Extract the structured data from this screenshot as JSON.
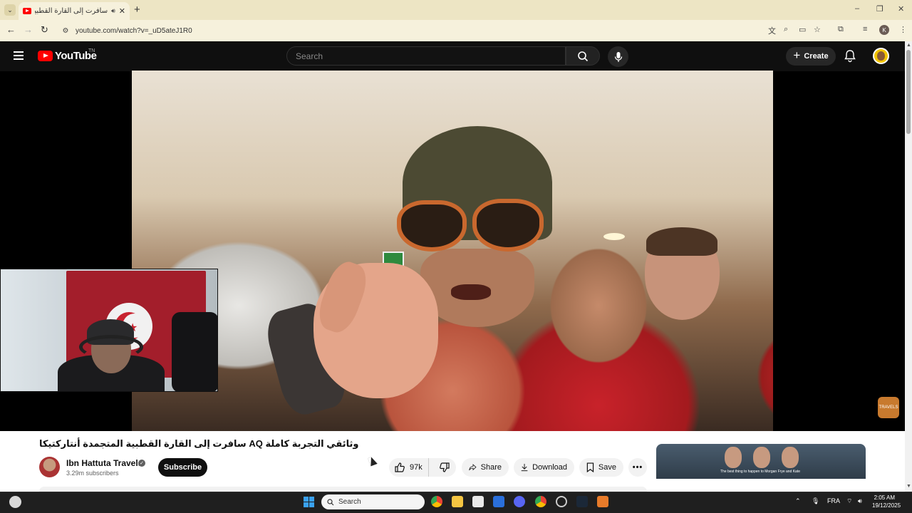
{
  "browser": {
    "tab_title": "سافرت إلى القارة القطبية ال",
    "tab_icon": "youtube-favicon-icon",
    "audio_icon": "speaker-icon",
    "close_glyph": "✕",
    "newtab_glyph": "+",
    "url": "youtube.com/watch?v=_uD5ateJ1R0",
    "profile_initial": "K",
    "window_controls": [
      "–",
      "❐",
      "✕"
    ]
  },
  "youtube": {
    "logo_text": "YouTube",
    "logo_country": "TN",
    "search_placeholder": "Search",
    "create_label": "Create",
    "create_glyph": "+"
  },
  "video": {
    "title": "وثائقي التجربة كاملة AQ سافرت إلى القارة القطبية المتجمدة أنتاركتيكا",
    "watermark_text": "TRAVELS"
  },
  "channel": {
    "name": "Ibn Hattuta Travels",
    "subscribers": "3.29m subscribers",
    "subscribe_label": "Subscribe",
    "verified_glyph": "✓"
  },
  "actions": {
    "like_count": "97k",
    "share_label": "Share",
    "download_label": "Download",
    "save_label": "Save",
    "more_glyph": "•••"
  },
  "recommendation": {
    "caption": "The best thing to happen to Morgan Frye and Kate"
  },
  "taskbar": {
    "search_placeholder": "Search",
    "language": "FRA",
    "time": "2:05 AM",
    "date": "19/12/2025"
  },
  "colors": {
    "youtube_red": "#ff0000",
    "chrome_frame": "#ede5c4",
    "dark_bg": "#0f0f0f",
    "subscribe_bg": "#0f0f0f",
    "action_bg": "#f2f2f2"
  }
}
